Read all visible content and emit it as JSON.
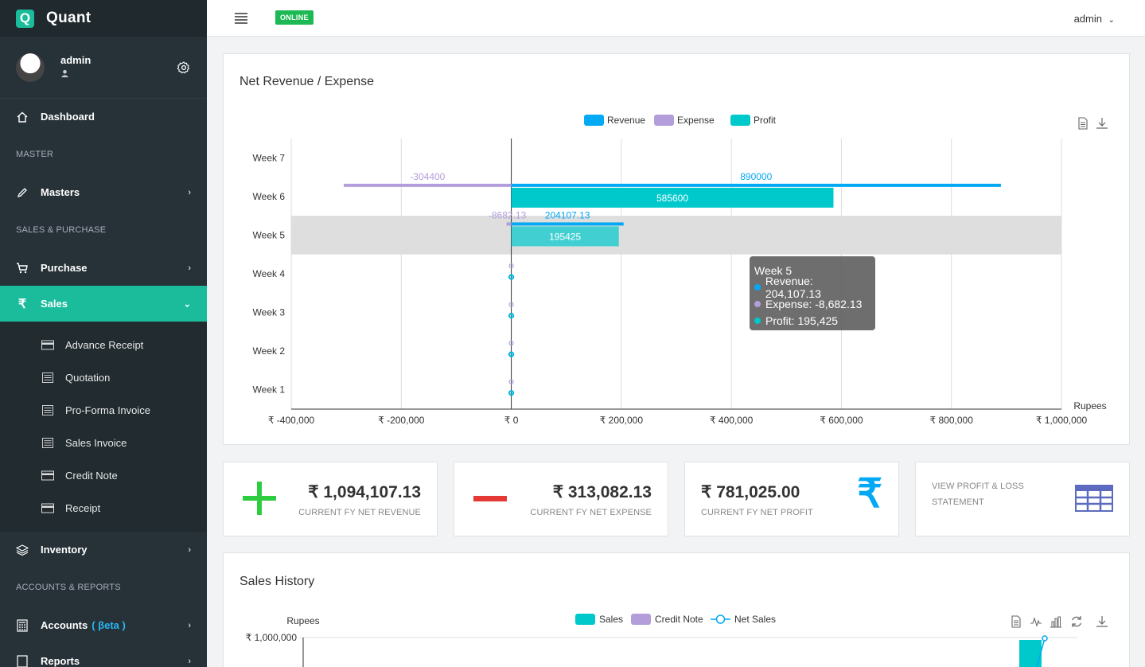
{
  "brand": {
    "logo_letter": "Q",
    "name": "Quant"
  },
  "user": {
    "name": "admin"
  },
  "sidebar": {
    "dashboard": "Dashboard",
    "section_master": "MASTER",
    "masters": "Masters",
    "section_sales_purchase": "SALES & PURCHASE",
    "purchase": "Purchase",
    "sales": "Sales",
    "sales_submenu": [
      "Advance Receipt",
      "Quotation",
      "Pro-Forma Invoice",
      "Sales Invoice",
      "Credit Note",
      "Receipt"
    ],
    "inventory": "Inventory",
    "section_accounts": "ACCOUNTS & REPORTS",
    "accounts": "Accounts",
    "accounts_beta": "( βeta )",
    "reports": "Reports"
  },
  "topbar": {
    "status": "ONLINE",
    "user_menu": "admin"
  },
  "revenue_card": {
    "title": "Net Revenue / Expense"
  },
  "stats": {
    "revenue_value": "₹ 1,094,107.13",
    "revenue_label": "CURRENT FY NET REVENUE",
    "expense_value": "₹ 313,082.13",
    "expense_label": "CURRENT FY NET EXPENSE",
    "profit_value": "₹ 781,025.00",
    "profit_label": "CURRENT FY NET PROFIT",
    "pl_line1": "VIEW PROFIT & LOSS",
    "pl_line2": "STATEMENT"
  },
  "sales_card": {
    "title": "Sales History"
  },
  "tooltip": {
    "title": "Week 5",
    "revenue": "Revenue: 204,107.13",
    "expense": "Expense: -8,682.13",
    "profit": "Profit: 195,425"
  },
  "colors": {
    "revenue": "#03a9f4",
    "expense": "#b39ddb",
    "profit": "#00c9cc",
    "accent": "#1abc9c",
    "sidebar": "#263238"
  },
  "chart_data": [
    {
      "type": "bar",
      "orientation": "horizontal",
      "categories": [
        "Week 1",
        "Week 2",
        "Week 3",
        "Week 4",
        "Week 5",
        "Week 6",
        "Week 7"
      ],
      "series": [
        {
          "name": "Revenue",
          "values": [
            0,
            0,
            0,
            0,
            204107.13,
            890000,
            null
          ]
        },
        {
          "name": "Expense",
          "values": [
            0,
            0,
            0,
            0,
            -8682.13,
            -304400,
            null
          ]
        },
        {
          "name": "Profit",
          "values": [
            0,
            0,
            0,
            0,
            195425,
            585600,
            null
          ]
        }
      ],
      "data_labels": {
        "Week 5": [
          "-8682.13",
          "204107.13",
          "195425"
        ],
        "Week 6": [
          "-304400",
          "890000",
          "585600"
        ]
      },
      "xlabel": "Rupees",
      "xlim": [
        -400000,
        1000000
      ],
      "x_ticks": [
        "₹ -400,000",
        "₹ -200,000",
        "₹ 0",
        "₹ 200,000",
        "₹ 400,000",
        "₹ 600,000",
        "₹ 800,000",
        "₹ 1,000,000"
      ],
      "grid": true,
      "legend": "top-center",
      "highlighted_category": "Week 5"
    },
    {
      "type": "bar",
      "series": [
        {
          "name": "Sales"
        },
        {
          "name": "Credit Note"
        },
        {
          "name": "Net Sales"
        }
      ],
      "ylabel": "Rupees",
      "y_ticks": [
        "₹ 1,000,000"
      ],
      "legend": "top-center"
    }
  ]
}
